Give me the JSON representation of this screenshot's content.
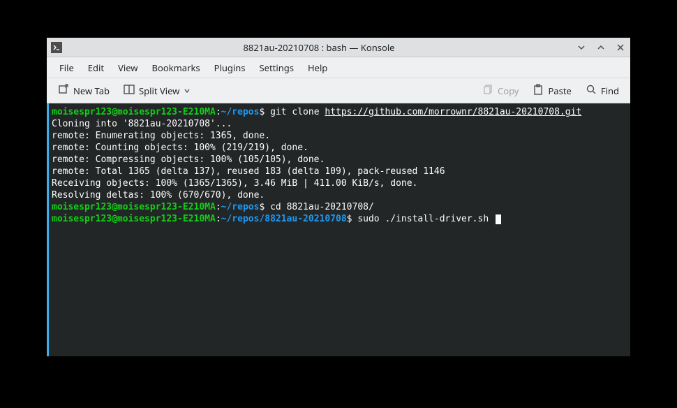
{
  "titlebar": {
    "title": "8821au-20210708 : bash — Konsole"
  },
  "menubar": {
    "items": [
      "File",
      "Edit",
      "View",
      "Bookmarks",
      "Plugins",
      "Settings",
      "Help"
    ]
  },
  "toolbar": {
    "new_tab": "New Tab",
    "split_view": "Split View",
    "copy": "Copy",
    "paste": "Paste",
    "find": "Find"
  },
  "terminal": {
    "prompt1_user": "moisespr123@moisespr123-E210MA",
    "prompt1_sep": ":",
    "prompt1_path": "~/repos",
    "prompt1_dollar": "$ ",
    "cmd1": "git clone ",
    "cmd1_url": "https://github.com/morrownr/8821au-20210708.git",
    "out1": "Cloning into '8821au-20210708'...",
    "out2": "remote: Enumerating objects: 1365, done.",
    "out3": "remote: Counting objects: 100% (219/219), done.",
    "out4": "remote: Compressing objects: 100% (105/105), done.",
    "out5": "remote: Total 1365 (delta 137), reused 183 (delta 109), pack-reused 1146",
    "out6": "Receiving objects: 100% (1365/1365), 3.46 MiB | 411.00 KiB/s, done.",
    "out7": "Resolving deltas: 100% (670/670), done.",
    "prompt2_user": "moisespr123@moisespr123-E210MA",
    "prompt2_sep": ":",
    "prompt2_path": "~/repos",
    "prompt2_dollar": "$ ",
    "cmd2": "cd 8821au-20210708/",
    "prompt3_user": "moisespr123@moisespr123-E210MA",
    "prompt3_sep": ":",
    "prompt3_path": "~/repos/8821au-20210708",
    "prompt3_dollar": "$ ",
    "cmd3": "sudo ./install-driver.sh "
  }
}
